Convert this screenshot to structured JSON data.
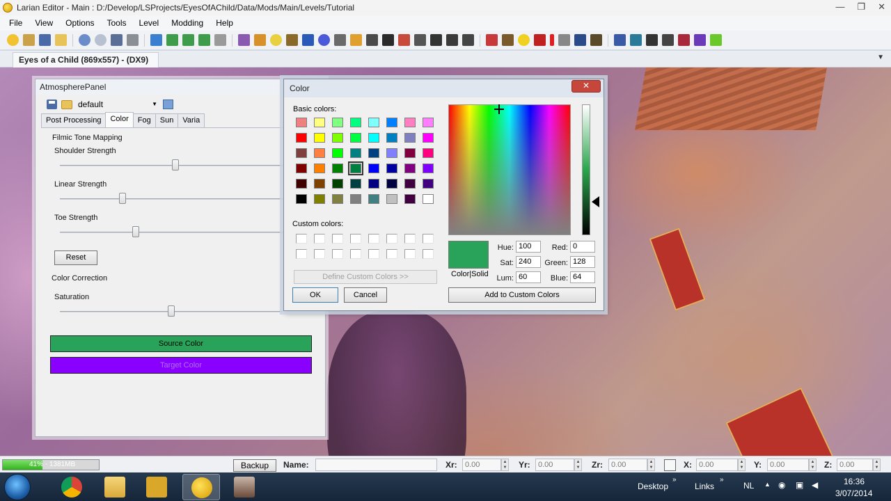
{
  "window": {
    "title": "Larian Editor - Main : D:/Develop/LSProjects/EyesOfAChild/Data/Mods/Main/Levels/Tutorial",
    "min": "—",
    "max": "❐",
    "close": "✕"
  },
  "menu": [
    "File",
    "View",
    "Options",
    "Tools",
    "Level",
    "Modding",
    "Help"
  ],
  "doc_tab": "Eyes of a Child (869x557) - (DX9)",
  "atmosphere_panel": {
    "title": "AtmospherePanel",
    "preset": "default",
    "tabs": [
      "Post Processing",
      "Color",
      "Fog",
      "Sun",
      "Varia"
    ],
    "active_tab": "Color",
    "section_filmic": "Filmic Tone Mapping",
    "shoulder_label": "Shoulder Strength",
    "linear_label": "Linear Strength",
    "toe_label": "Toe Strength",
    "reset_label": "Reset",
    "section_color_correction": "Color Correction",
    "saturation_label": "Saturation",
    "source_color_label": "Source Color",
    "target_color_label": "Target Color",
    "source_color": "#2aa35a",
    "target_color": "#8a00ff",
    "slider_levels": {
      "shoulder": 0.52,
      "linear": 0.28,
      "toe": 0.34,
      "saturation": 0.5
    }
  },
  "color_dialog": {
    "title": "Color",
    "basic_colors_label": "Basic colors:",
    "custom_colors_label": "Custom colors:",
    "define_custom_label": "Define Custom Colors >>",
    "ok_label": "OK",
    "cancel_label": "Cancel",
    "add_custom_label": "Add to Custom Colors",
    "color_solid_label": "Color|Solid",
    "hue_label": "Hue:",
    "hue": "100",
    "sat_label": "Sat:",
    "sat": "240",
    "lum_label": "Lum:",
    "lum": "60",
    "red_label": "Red:",
    "red": "0",
    "green_label": "Green:",
    "green": "128",
    "blue_label": "Blue:",
    "blue": "64",
    "current_color": "#008040",
    "basic_colors": [
      [
        "#f08080",
        "#ffff80",
        "#80ff80",
        "#00ff80",
        "#80ffff",
        "#0080ff",
        "#ff80c0",
        "#ff80ff"
      ],
      [
        "#ff0000",
        "#ffff00",
        "#80ff00",
        "#00ff40",
        "#00ffff",
        "#0080c0",
        "#8080c0",
        "#ff00ff"
      ],
      [
        "#804040",
        "#ff8040",
        "#00ff00",
        "#008080",
        "#004080",
        "#8080ff",
        "#800040",
        "#ff0080"
      ],
      [
        "#800000",
        "#ff8000",
        "#008000",
        "#008040",
        "#0000ff",
        "#0000a0",
        "#800080",
        "#8000ff"
      ],
      [
        "#400000",
        "#804000",
        "#004000",
        "#004040",
        "#000080",
        "#000040",
        "#400040",
        "#400080"
      ],
      [
        "#000000",
        "#808000",
        "#808040",
        "#808080",
        "#408080",
        "#c0c0c0",
        "#400040",
        "#ffffff"
      ]
    ],
    "selected_swatch": [
      3,
      3
    ]
  },
  "statusbar": {
    "memory_text": "41% - 1381MB",
    "memory_fraction": 0.41,
    "backup_label": "Backup",
    "name_label": "Name:",
    "xr_label": "Xr:",
    "xr": "0.00",
    "yr_label": "Yr:",
    "yr": "0.00",
    "zr_label": "Zr:",
    "zr": "0.00",
    "x_label": "X:",
    "x": "0.00",
    "y_label": "Y:",
    "y": "0.00",
    "z_label": "Z:",
    "z": "0.00"
  },
  "taskbar": {
    "desktop_label": "Desktop",
    "links_label": "Links",
    "lang": "NL",
    "time": "16:36",
    "date": "3/07/2014"
  }
}
